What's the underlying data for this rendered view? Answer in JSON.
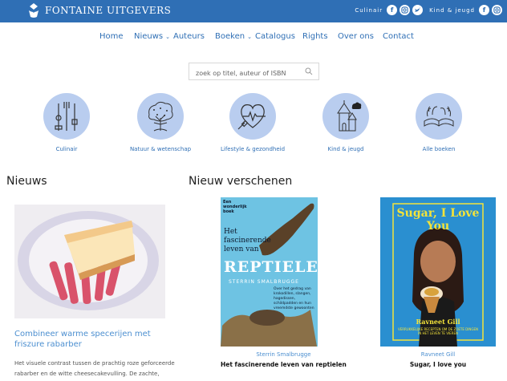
{
  "header": {
    "brand_name": "FONTAINE UITGEVERS",
    "social_label_1": "Culinair",
    "social_label_2": "Kind & jeugd",
    "brand_color": "#2f6fb5"
  },
  "nav": {
    "items": [
      {
        "label": "Home"
      },
      {
        "label": "Nieuws"
      },
      {
        "label": "Auteurs"
      },
      {
        "label": "Boeken"
      },
      {
        "label": "Catalogus"
      },
      {
        "label": "Rights"
      },
      {
        "label": "Over ons"
      },
      {
        "label": "Contact"
      }
    ]
  },
  "search": {
    "placeholder": "zoek op titel, auteur of ISBN"
  },
  "categories": [
    {
      "label": "Culinair",
      "icon": "utensils-icon"
    },
    {
      "label": "Natuur & wetenschap",
      "icon": "tree-icon"
    },
    {
      "label": "Lifestyle & gezondheid",
      "icon": "heart-pulse-icon"
    },
    {
      "label": "Kind & jeugd",
      "icon": "castle-icon"
    },
    {
      "label": "Alle boeken",
      "icon": "open-book-icon"
    }
  ],
  "news": {
    "heading": "Nieuws",
    "title": "Combineer warme specerijen met friszure rabarber",
    "excerpt": "Het visuele contrast tussen de prachtig roze geforceerde rabarber en de witte cheesecakevulling. De zachte,"
  },
  "new_releases": {
    "heading": "Nieuw verschenen",
    "books": [
      {
        "author": "Sterrin Smalbrugge",
        "title": "Het fascinerende leven van reptielen",
        "cover": {
          "tagline": "Een wonderlijk boek",
          "title_top": "Het fascinerende leven van",
          "title_big": "REPTIELEN",
          "author": "STERRIN SMALBRUGGE",
          "blurb": "Over het gedrag van krokodillen, slangen, hagedissen, schildpadden en hun vreemdste gewoonten"
        }
      },
      {
        "author": "Ravneet Gill",
        "title": "Sugar, I love you",
        "cover": {
          "title": "Sugar, I Love You",
          "author": "Ravneet Gill",
          "blurb": "VERRUKKELIJKE RECEPTEN OM DE ZOETE DINGEN IN HET LEVEN TE VIEREN"
        }
      }
    ]
  }
}
